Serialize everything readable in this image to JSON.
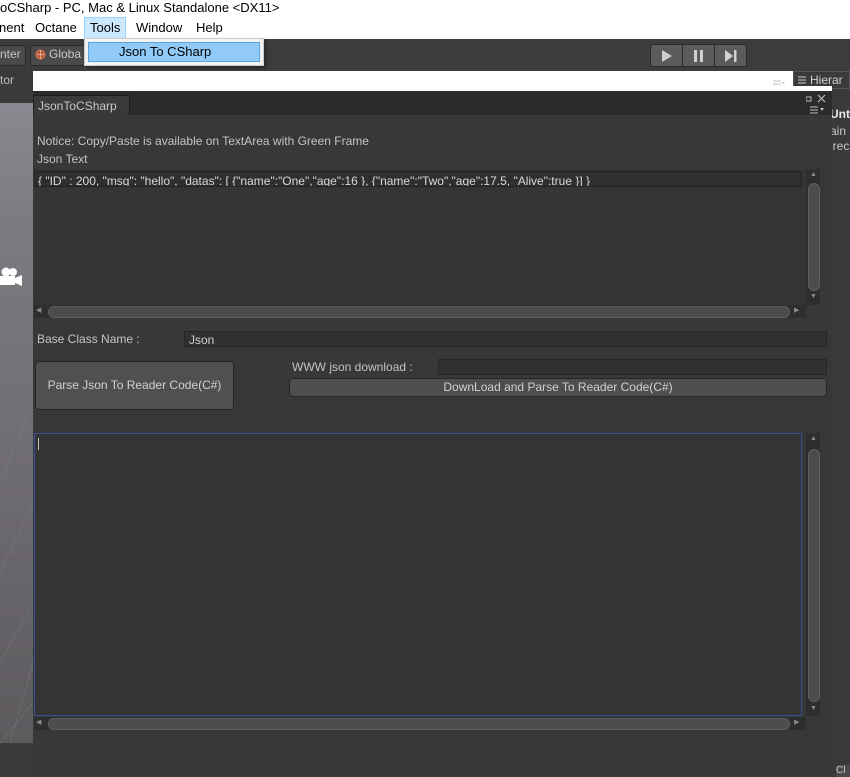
{
  "window": {
    "title": "oCSharp - PC, Mac & Linux Standalone <DX11>"
  },
  "menu": {
    "items": [
      "nent",
      "Octane",
      "Tools",
      "Window",
      "Help"
    ],
    "active": "Tools",
    "dropdown_item": "Json To CSharp"
  },
  "toolbar": {
    "left_label": "nter",
    "global_label": "Globa",
    "play_icon": "play-icon",
    "pause_icon": "pause-icon",
    "step_icon": "step-icon"
  },
  "side": {
    "left_panel_label": "tor",
    "hierarchy_tab": "Hierar",
    "right_text_1": "Unti",
    "right_text_2": "ain",
    "right_text_3": "irec",
    "bottom_right": "Cl"
  },
  "editor": {
    "tab_title": "JsonToCSharp",
    "notice": "Notice: Copy/Paste is available on TextArea with Green Frame",
    "json_text_label": "Json Text",
    "json_text_value": "{ \"ID\" : 200, \"msg\": \"hello\", \"datas\": [ {\"name\":\"One\",\"age\":16 }, {\"name\":\"Two\",\"age\":17.5, \"Alive\":true }] }",
    "base_class_label": "Base Class Name :",
    "base_class_value": "Json",
    "parse_button": "Parse Json To Reader Code(C#)",
    "www_label": "WWW json download :",
    "www_value": "",
    "download_button": "DownLoad and Parse To Reader Code(C#)",
    "output_value": ""
  },
  "colors": {
    "accent": "#91c9f7",
    "menu_highlight": "#cce8ff",
    "panel_bg": "#383838",
    "output_border": "#3a4f9a"
  }
}
